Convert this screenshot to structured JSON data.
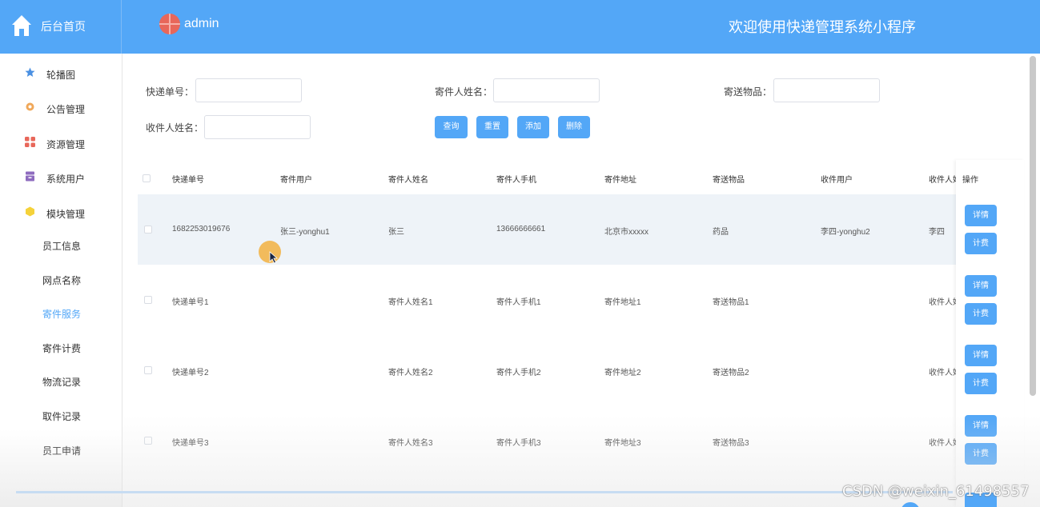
{
  "header": {
    "brand": "后台首页",
    "username": "admin",
    "welcome": "欢迎使用快递管理系统小程序"
  },
  "sidebar": {
    "menus": [
      {
        "label": "轮播图",
        "icon": "star-icon",
        "color": "#4a90e2"
      },
      {
        "label": "公告管理",
        "icon": "gear-icon",
        "color": "#f0a85a"
      },
      {
        "label": "资源管理",
        "icon": "grid-icon",
        "color": "#e8675a"
      },
      {
        "label": "系统用户",
        "icon": "box-icon",
        "color": "#8e6bbf"
      },
      {
        "label": "模块管理",
        "icon": "hexagon-icon",
        "color": "#f5d23a"
      }
    ],
    "subs": [
      "员工信息",
      "网点名称",
      "寄件服务",
      "寄件计费",
      "物流记录",
      "取件记录",
      "员工申请"
    ],
    "active_sub": "寄件服务"
  },
  "search": {
    "tracking_label": "快递单号：",
    "sender_name_label": "寄件人姓名：",
    "item_label": "寄送物品：",
    "receiver_name_label": "收件人姓名：",
    "tracking_value": "",
    "sender_name_value": "",
    "item_value": "",
    "receiver_name_value": "",
    "buttons": {
      "query": "查询",
      "reset": "重置",
      "add": "添加",
      "delete": "删除"
    }
  },
  "table": {
    "headers": [
      "快递单号",
      "寄件用户",
      "寄件人姓名",
      "寄件人手机",
      "寄件地址",
      "寄送物品",
      "收件用户",
      "收件人姓",
      "操作"
    ],
    "rows": [
      [
        "1682253019676",
        "张三-yonghu1",
        "张三",
        "13666666661",
        "北京市xxxxx",
        "药品",
        "李四-yonghu2",
        "李四"
      ],
      [
        "快递单号1",
        "",
        "寄件人姓名1",
        "寄件人手机1",
        "寄件地址1",
        "寄送物品1",
        "",
        "收件人姓"
      ],
      [
        "快递单号2",
        "",
        "寄件人姓名2",
        "寄件人手机2",
        "寄件地址2",
        "寄送物品2",
        "",
        "收件人姓"
      ],
      [
        "快递单号3",
        "",
        "寄件人姓名3",
        "寄件人手机3",
        "寄件地址3",
        "寄送物品3",
        "",
        "收件人姓"
      ]
    ],
    "detail_label": "详情",
    "fee_label": "计费"
  },
  "watermark": "CSDN @weixin_61498557",
  "colors": {
    "primary": "#53a7f7",
    "active_text": "#53a7f7"
  }
}
